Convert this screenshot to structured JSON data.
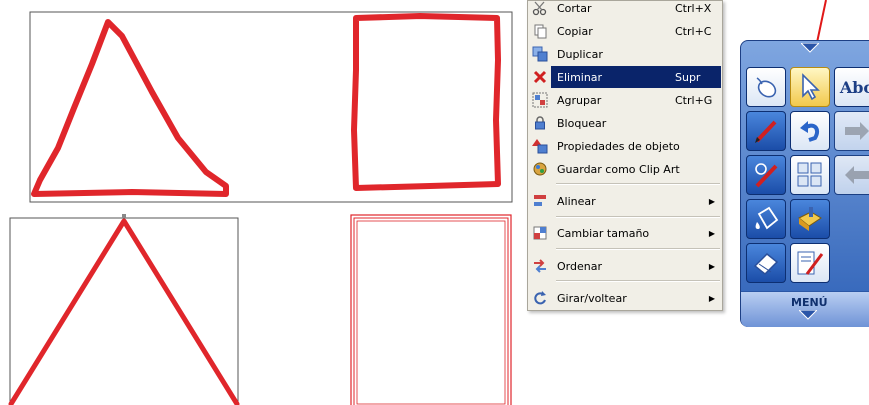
{
  "context_menu": {
    "items": [
      {
        "label": "Cortar",
        "shortcut": "Ctrl+X",
        "icon": "scissors-icon"
      },
      {
        "label": "Copiar",
        "shortcut": "Ctrl+C",
        "icon": "copy-icon"
      },
      {
        "label": "Duplicar",
        "shortcut": "",
        "icon": "duplicate-icon"
      },
      {
        "label": "Eliminar",
        "shortcut": "Supr",
        "icon": "delete-x-icon",
        "selected": true
      },
      {
        "label": "Agrupar",
        "shortcut": "Ctrl+G",
        "icon": "group-icon"
      },
      {
        "label": "Bloquear",
        "shortcut": "",
        "icon": "lock-icon"
      },
      {
        "label": "Propiedades de objeto",
        "shortcut": "",
        "icon": "properties-icon"
      },
      {
        "label": "Guardar como Clip Art",
        "shortcut": "",
        "icon": "clipart-icon"
      },
      {
        "label": "Alinear",
        "icon": "align-icon",
        "submenu": true
      },
      {
        "label": "Cambiar tamaño",
        "icon": "resize-icon",
        "submenu": true
      },
      {
        "label": "Ordenar",
        "icon": "order-icon",
        "submenu": true
      },
      {
        "label": "Girar/voltear",
        "icon": "rotate-icon",
        "submenu": true
      }
    ],
    "submenu_arrow": "▶"
  },
  "toolbar": {
    "text_tool_label": "Abc",
    "menu_label": "MENÚ"
  },
  "colors": {
    "shape_red": "#e0262b",
    "selection_highlight": "#0a246a",
    "annotation_arrow": "#e01818"
  }
}
